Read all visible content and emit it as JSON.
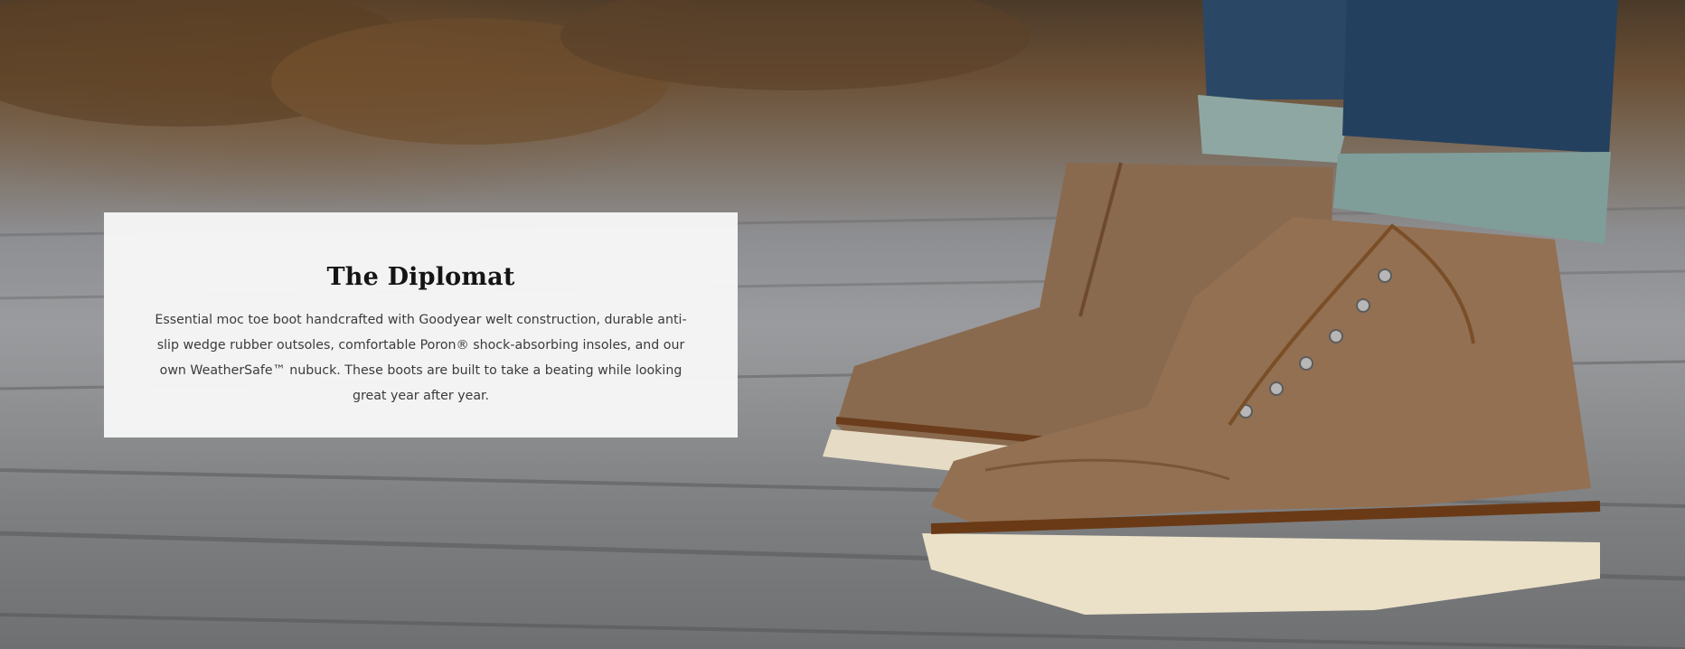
{
  "hero": {
    "image_alt_icon": "boots-photo",
    "colors": {
      "boot_leather": "#8f6e52",
      "boot_sole": "#e8dcc2",
      "denim": "#27415d",
      "card_background": "#f7f7f7",
      "title_color": "#151515",
      "text_color": "#3b3b3b"
    }
  },
  "card": {
    "title": "The Diplomat",
    "description": "Essential moc toe boot handcrafted with Goodyear welt construction, durable anti-slip wedge rubber outsoles, comfortable Poron® shock-absorbing insoles, and our own WeatherSafe™ nubuck. These boots are built to take a beating while looking great year after year."
  }
}
